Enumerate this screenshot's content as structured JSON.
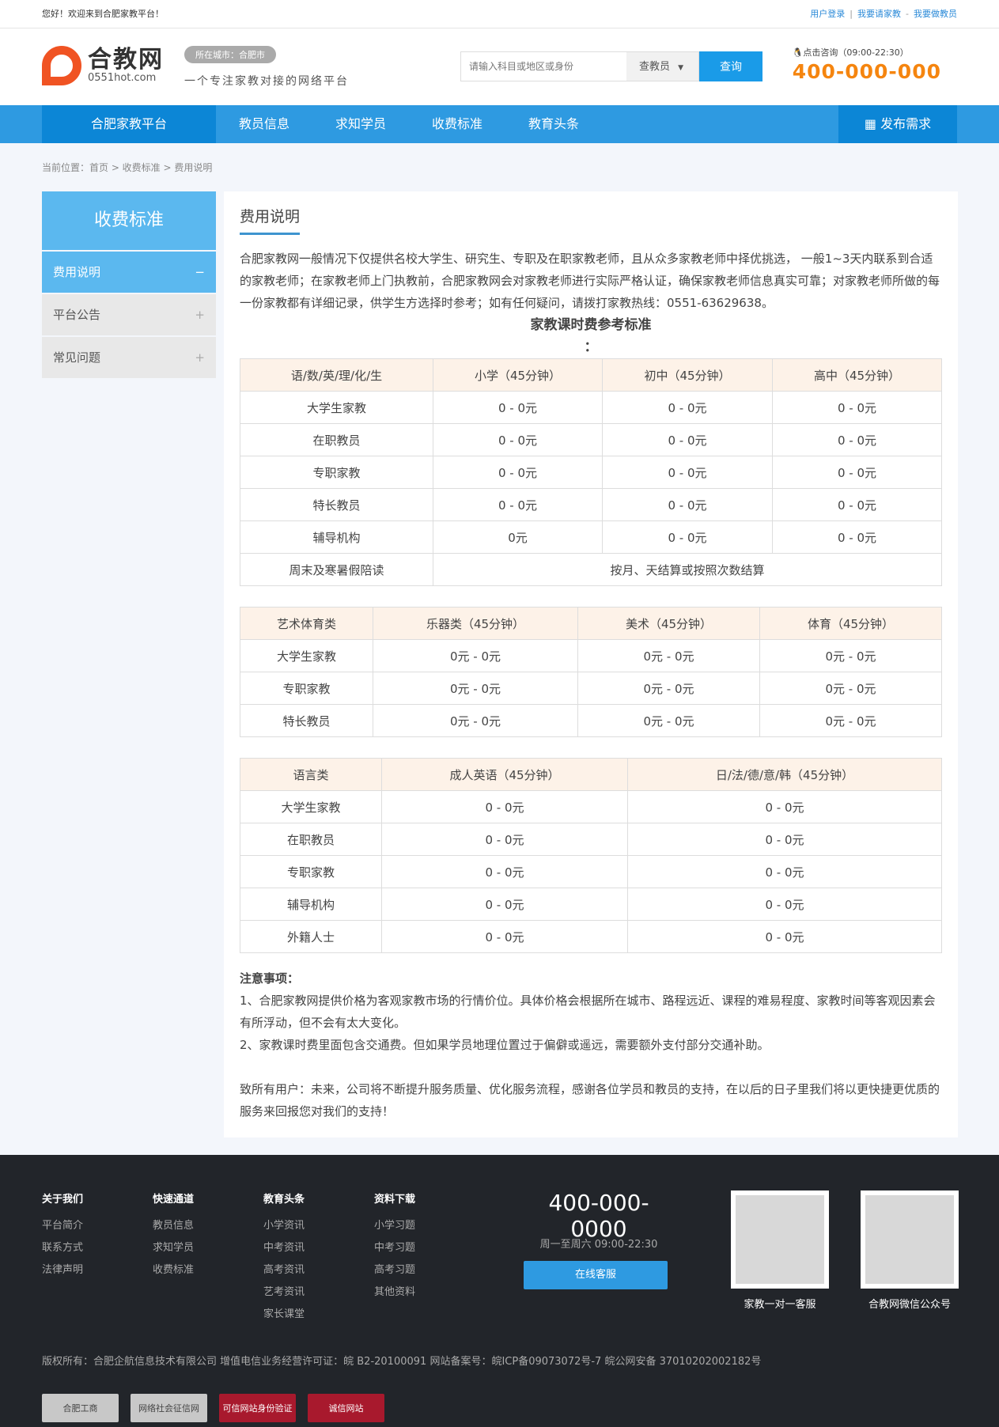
{
  "topbar": {
    "welcome": "您好！欢迎来到合肥家教平台！",
    "links": [
      "用户登录",
      "我要请家教",
      "我要做教员"
    ]
  },
  "header": {
    "logo_name": "合教网",
    "logo_url": "0551hot.com",
    "city": "所在城市：合肥市",
    "slogan": "一个专注家教对接的网络平台",
    "search_placeholder": "请输入科目或地区或身份",
    "search_type": "查教员",
    "search_button": "查询",
    "contact_label": "点击咨询（09:00-22:30）",
    "phone": "400-000-000"
  },
  "nav": {
    "home": "合肥家教平台",
    "items": [
      "教员信息",
      "求知学员",
      "收费标准",
      "教育头条"
    ],
    "publish": "发布需求"
  },
  "breadcrumb": "当前位置：首页 > 收费标准 > 费用说明",
  "sidebar": {
    "title": "收费标准",
    "items": [
      {
        "label": "费用说明",
        "sign": "−"
      },
      {
        "label": "平台公告",
        "sign": "+"
      },
      {
        "label": "常见问题",
        "sign": "+"
      }
    ]
  },
  "main": {
    "title": "费用说明",
    "intro": "合肥家教网一般情况下仅提供名校大学生、研究生、专职及在职家教老师，且从众多家教老师中择优挑选， 一般1~3天内联系到合适的家教老师；在家教老师上门执教前，合肥家教网会对家教老师进行实际严格认证，确保家教老师信息真实可靠；对家教老师所做的每一份家教都有详细记录，供学生方选择时参考；如有任何疑问，请拨打家教热线：0551-63629638。",
    "table_title": "家教课时费参考标准",
    "colon": "：",
    "table1": {
      "header": [
        "语/数/英/理/化/生",
        "小学（45分钟）",
        "初中（45分钟）",
        "高中（45分钟）"
      ],
      "rows": [
        [
          "大学生家教",
          "0 - 0元",
          "0 - 0元",
          "0 - 0元"
        ],
        [
          "在职教员",
          "0 - 0元",
          "0 - 0元",
          "0 - 0元"
        ],
        [
          "专职家教",
          "0 - 0元",
          "0 - 0元",
          "0 - 0元"
        ],
        [
          "特长教员",
          "0 - 0元",
          "0 - 0元",
          "0 - 0元"
        ],
        [
          "辅导机构",
          "0元",
          "0 - 0元",
          "0 - 0元"
        ]
      ],
      "last_row": [
        "周末及寒暑假陪读",
        "按月、天结算或按照次数结算"
      ]
    },
    "table2": {
      "header": [
        "艺术体育类",
        "乐器类（45分钟）",
        "美术（45分钟）",
        "体育（45分钟）"
      ],
      "rows": [
        [
          "大学生家教",
          "0元 - 0元",
          "0元 - 0元",
          "0元 - 0元"
        ],
        [
          "专职家教",
          "0元 - 0元",
          "0元 - 0元",
          "0元 - 0元"
        ],
        [
          "特长教员",
          "0元 - 0元",
          "0元 - 0元",
          "0元 - 0元"
        ]
      ]
    },
    "table3": {
      "header": [
        "语言类",
        "成人英语（45分钟）",
        "日/法/德/意/韩（45分钟）"
      ],
      "rows": [
        [
          "大学生家教",
          "0 - 0元",
          "0 - 0元"
        ],
        [
          "在职教员",
          "0 - 0元",
          "0 - 0元"
        ],
        [
          "专职家教",
          "0 - 0元",
          "0 - 0元"
        ],
        [
          "辅导机构",
          "0 - 0元",
          "0 - 0元"
        ],
        [
          "外籍人士",
          "0 - 0元",
          "0 - 0元"
        ]
      ]
    },
    "notes_title": "注意事项：",
    "note1": "1、合肥家教网提供价格为客观家教市场的行情价位。具体价格会根据所在城市、路程远近、课程的难易程度、家教时间等客观因素会有所浮动，但不会有太大变化。",
    "note2": "2、家教课时费里面包含交通费。但如果学员地理位置过于偏僻或遥远，需要额外支付部分交通补助。",
    "closing": "致所有用户：未来，公司将不断提升服务质量、优化服务流程，感谢各位学员和教员的支持，在以后的日子里我们将以更快捷更优质的服务来回报您对我们的支持！"
  },
  "footer": {
    "cols": [
      {
        "title": "关于我们",
        "items": [
          "平台简介",
          "联系方式",
          "法律声明"
        ]
      },
      {
        "title": "快速通道",
        "items": [
          "教员信息",
          "求知学员",
          "收费标准"
        ]
      },
      {
        "title": "教育头条",
        "items": [
          "小学资讯",
          "中考资讯",
          "高考资讯",
          "艺考资讯",
          "家长课堂"
        ]
      },
      {
        "title": "资料下载",
        "items": [
          "小学习题",
          "中考习题",
          "高考习题",
          "其他资料"
        ]
      }
    ],
    "phone": "400-000-0000",
    "hours": "周一至周六 09:00-22:30",
    "online": "在线客服",
    "qr1": "家教一对一客服",
    "qr2": "合教网微信公众号",
    "copyright": "版权所有：合肥企航信息技术有限公司 增值电信业务经营许可证：皖 B2-20100091 网站备案号：皖ICP备09073072号-7 皖公网安备 37010202002182号",
    "badges": [
      "合肥工商",
      "网络社会征信网",
      "可信网站身份验证",
      "诚信网站"
    ]
  }
}
